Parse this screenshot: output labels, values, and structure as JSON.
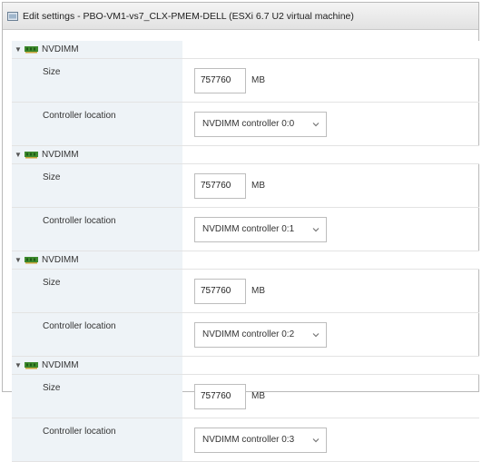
{
  "window": {
    "title": "Edit settings - PBO-VM1-vs7_CLX-PMEM-DELL (ESXi 6.7 U2 virtual machine)"
  },
  "icons": {
    "window": "vm-settings-icon",
    "section": "nvdimm-icon",
    "expand": "caret-down-icon",
    "select": "chevron-down-icon"
  },
  "colors": {
    "label_column_bg": "#eef3f7",
    "nvdimm_icon": "#3d8a2d"
  },
  "devices": [
    {
      "label": "NVDIMM",
      "size_label": "Size",
      "size_value": "757760",
      "size_unit": "MB",
      "controller_label": "Controller location",
      "controller_value": "NVDIMM controller 0:0"
    },
    {
      "label": "NVDIMM",
      "size_label": "Size",
      "size_value": "757760",
      "size_unit": "MB",
      "controller_label": "Controller location",
      "controller_value": "NVDIMM controller 0:1"
    },
    {
      "label": "NVDIMM",
      "size_label": "Size",
      "size_value": "757760",
      "size_unit": "MB",
      "controller_label": "Controller location",
      "controller_value": "NVDIMM controller 0:2"
    },
    {
      "label": "NVDIMM",
      "size_label": "Size",
      "size_value": "757760",
      "size_unit": "MB",
      "controller_label": "Controller location",
      "controller_value": "NVDIMM controller 0:3"
    }
  ]
}
